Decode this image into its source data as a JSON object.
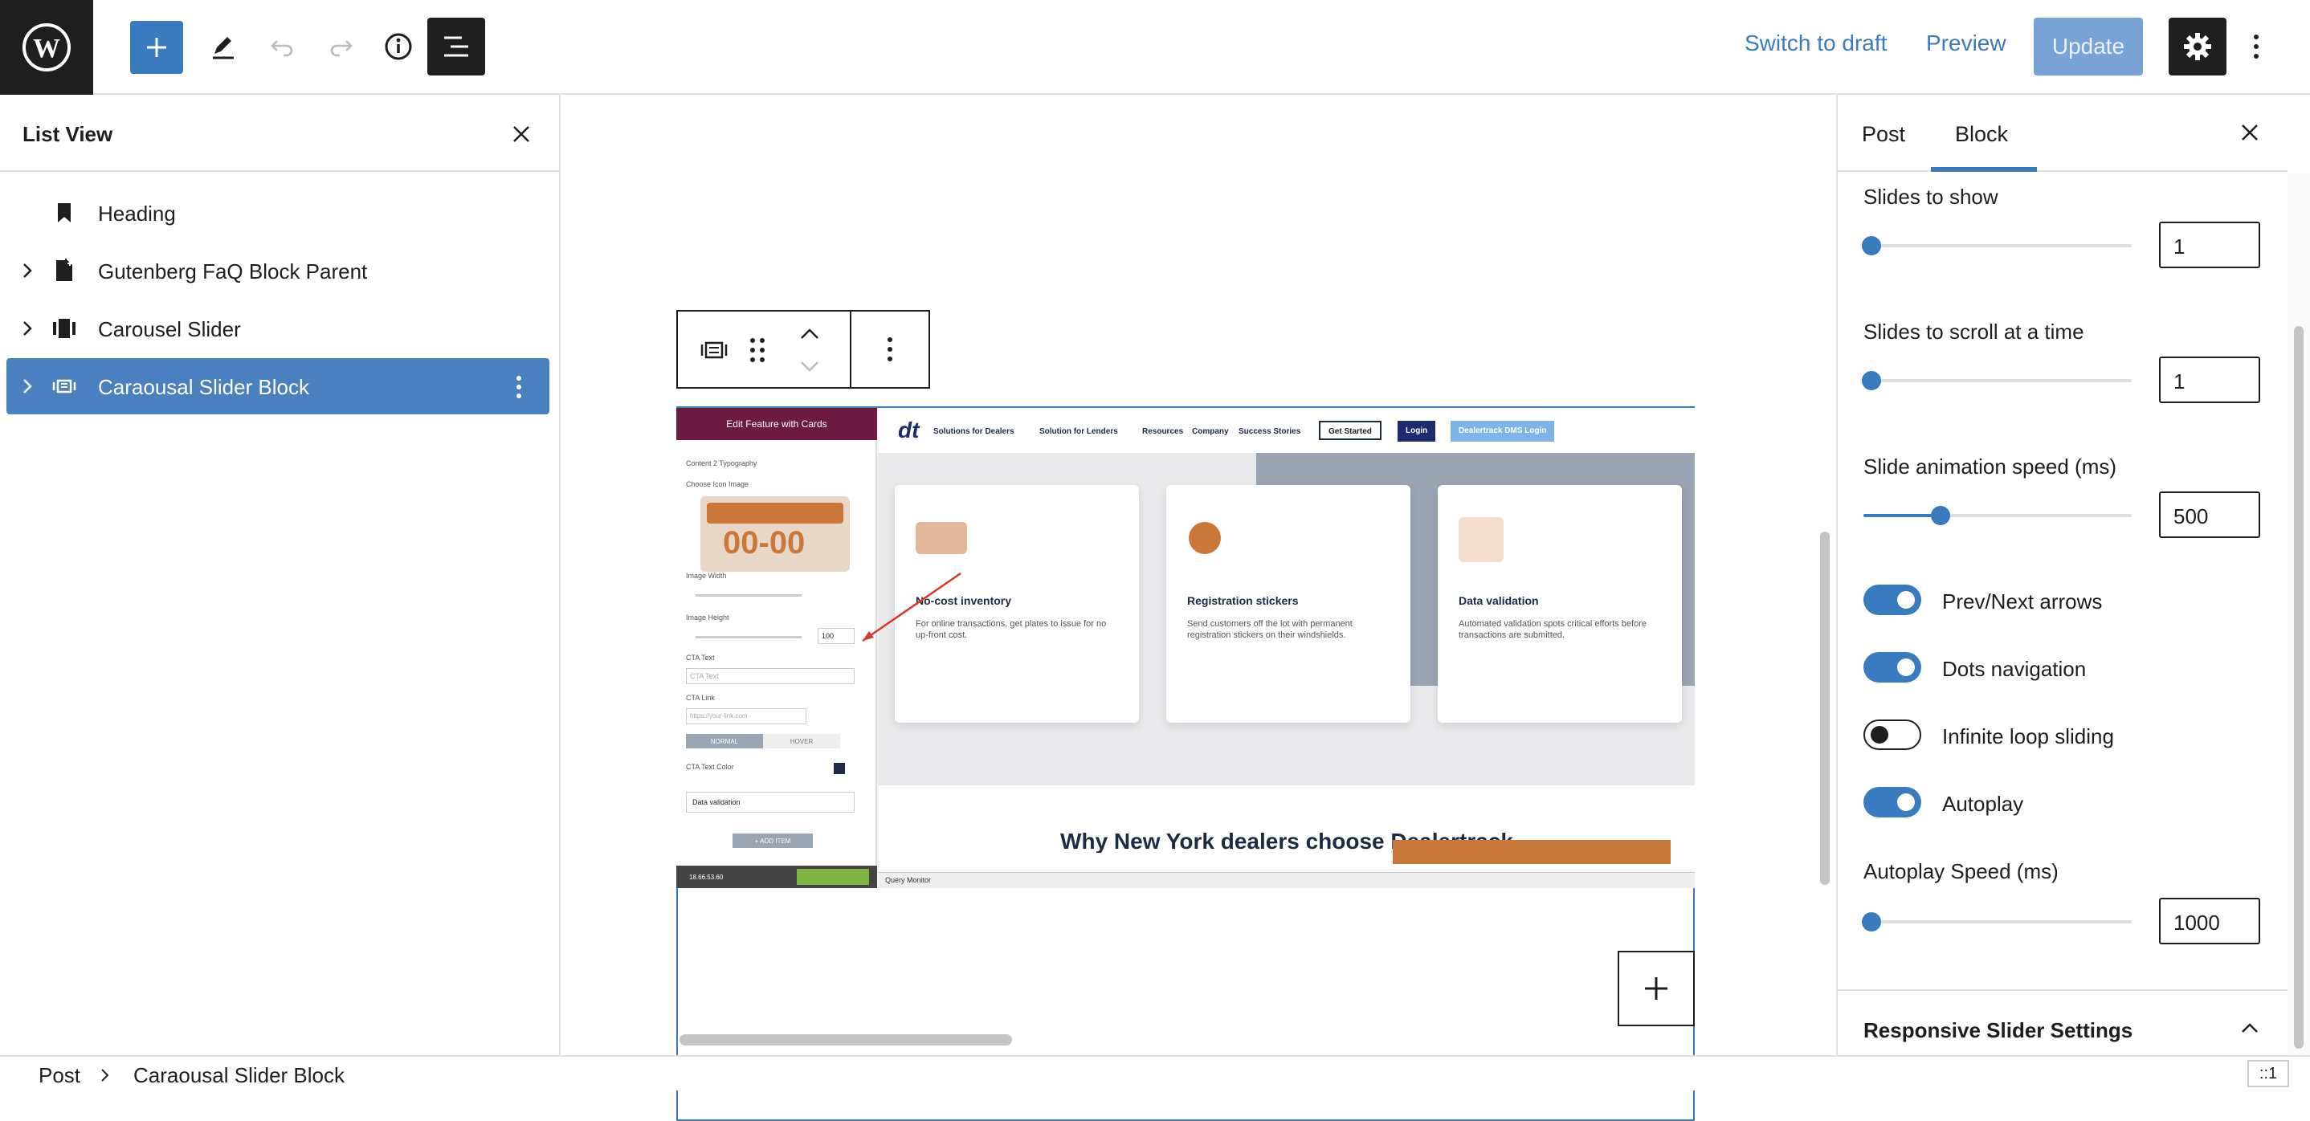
{
  "toolbar": {
    "switch_to_draft": "Switch to draft",
    "preview": "Preview",
    "update": "Update"
  },
  "list_view": {
    "title": "List View",
    "items": [
      {
        "label": "Heading",
        "icon": "bookmark-icon"
      },
      {
        "label": "Gutenberg FaQ Block Parent",
        "icon": "document-icon"
      },
      {
        "label": "Carousel Slider",
        "icon": "carousel-icon"
      },
      {
        "label": "Caraousal Slider Block",
        "icon": "slider-block-icon",
        "selected": true
      }
    ]
  },
  "sidebar": {
    "tabs": [
      "Post",
      "Block"
    ],
    "active_tab": "Block",
    "slides_to_show": {
      "label": "Slides to show",
      "value": "1"
    },
    "slides_to_scroll": {
      "label": "Slides to scroll at a time",
      "value": "1"
    },
    "animation_speed": {
      "label": "Slide animation speed (ms)",
      "value": "500"
    },
    "toggles": [
      {
        "label": "Prev/Next arrows",
        "on": true
      },
      {
        "label": "Dots navigation",
        "on": true
      },
      {
        "label": "Infinite loop sliding",
        "on": false
      },
      {
        "label": "Autoplay",
        "on": true
      }
    ],
    "autoplay_speed": {
      "label": "Autoplay Speed (ms)",
      "value": "1000"
    },
    "responsive_section": "Responsive Slider Settings"
  },
  "footer": {
    "breadcrumb_root": "Post",
    "breadcrumb_current": "Caraousal Slider Block",
    "counter": "::1"
  },
  "screenshot": {
    "panel_title": "Edit Feature with Cards",
    "panel_labels": [
      "Content 2 Typography",
      "Choose Icon Image",
      "Image Width",
      "Image Height",
      "CTA Text",
      "CTA Link",
      "CTA Text Color"
    ],
    "image_text": "00-00",
    "height_value": "100",
    "cta_placeholder": "CTA Text",
    "link_placeholder": "https://your-link.com",
    "state_tabs": [
      "NORMAL",
      "HOVER"
    ],
    "item_name": "Data validation",
    "add_item": "+ ADD ITEM",
    "bottom_ip": "18.66.53.60",
    "query_monitor": "Query Monitor",
    "nav": [
      "Solutions for Dealers",
      "Solution for Lenders",
      "Resources",
      "Company",
      "Success Stories"
    ],
    "get_started": "Get Started",
    "login": "Login",
    "dms_login": "Dealertrack DMS Login",
    "cards": [
      {
        "title": "No-cost inventory",
        "text": "For online transactions, get plates to issue for no up-front cost."
      },
      {
        "title": "Registration stickers",
        "text": "Send customers off the lot with permanent registration stickers on their windshields."
      },
      {
        "title": "Data validation",
        "text": "Automated validation spots critical efforts before transactions are submitted."
      }
    ],
    "bottom_heading": "Why New York dealers choose Dealertrack"
  },
  "colors": {
    "accent": "#3a7bbf",
    "selected_row": "#4a80c0",
    "update_btn": "#79a3d6",
    "dark": "#1e1e1e",
    "panel_header": "#6c1a3f"
  }
}
